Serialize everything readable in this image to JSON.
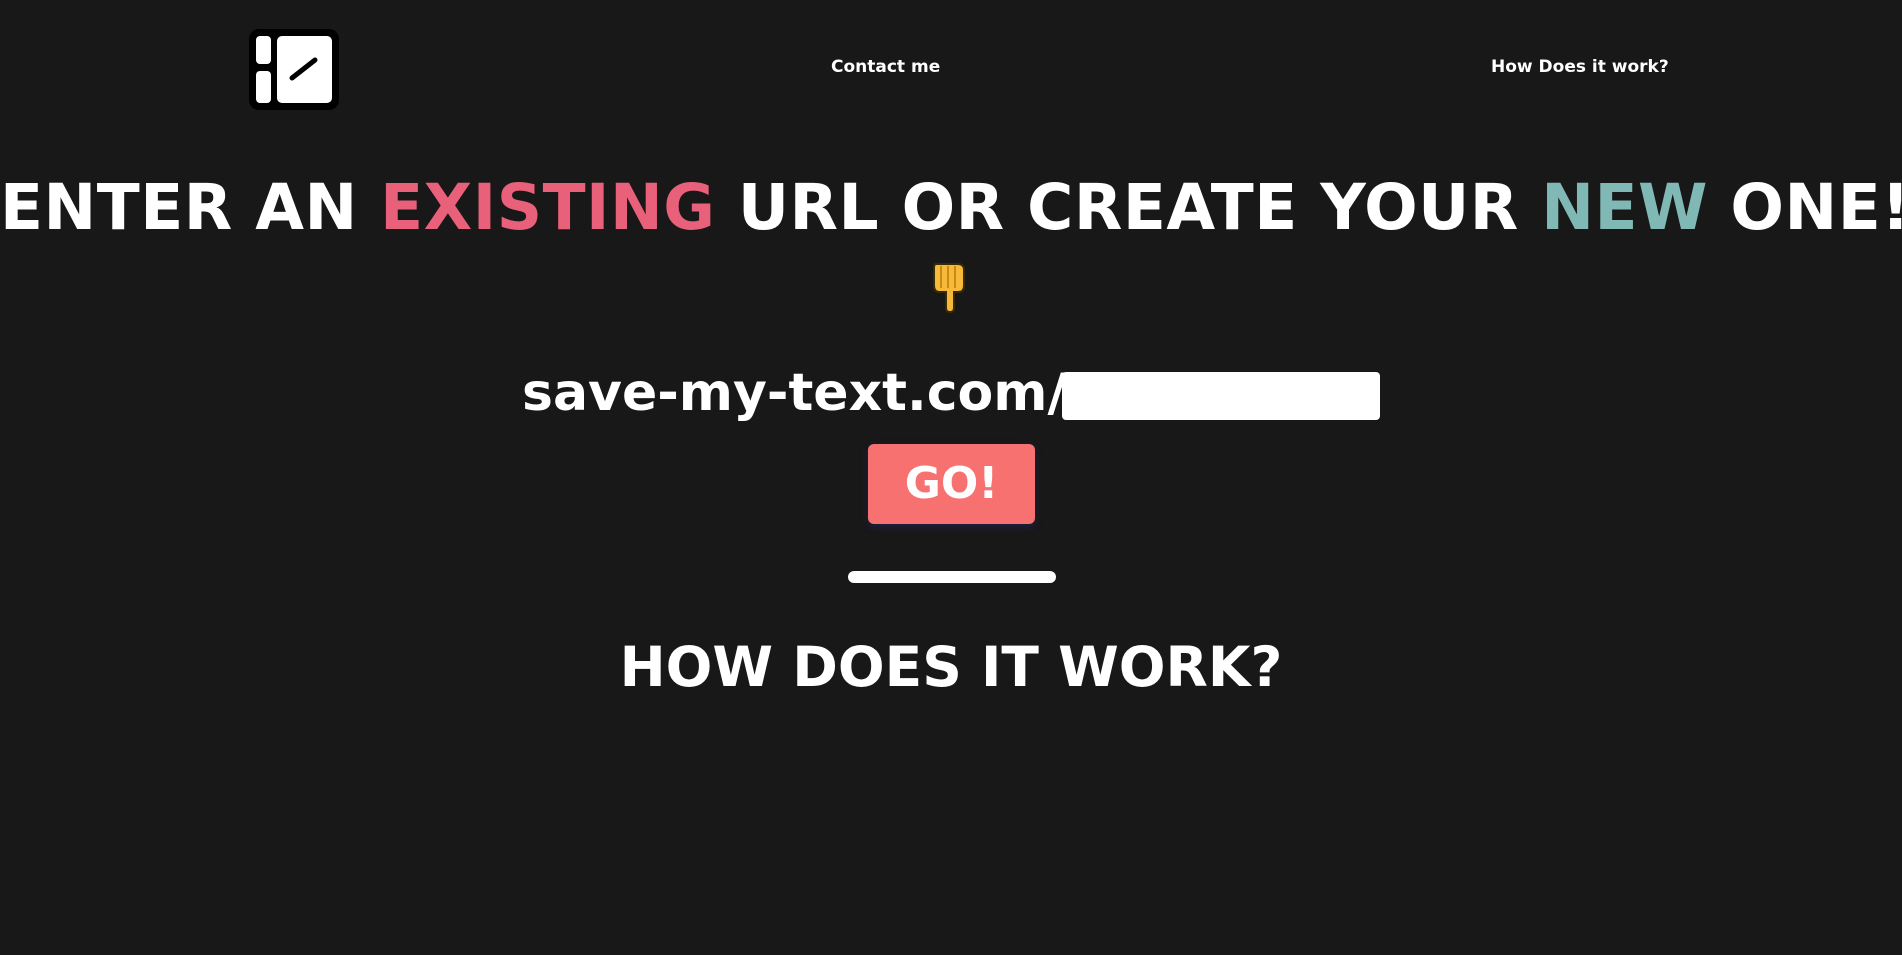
{
  "nav": {
    "logo_icon": "notebook-pencil-icon",
    "contact_label": "Contact me",
    "how_label": "How Does it work?"
  },
  "headline": {
    "part1": "ENTER AN ",
    "highlight1": "EXISTING",
    "part2": " URL OR CREATE YOUR ",
    "highlight2": "NEW",
    "part3": " ONE!"
  },
  "pointer_icon": "backhand-index-pointing-down-icon",
  "url_form": {
    "prefix": "save-my-text.com/",
    "input_value": "",
    "go_label": "GO!"
  },
  "section": {
    "title": "HOW DOES IT WORK?"
  },
  "colors": {
    "background": "#181818",
    "accent_red": "#e8607a",
    "accent_teal": "#7fb8b4",
    "button": "#f87171"
  }
}
